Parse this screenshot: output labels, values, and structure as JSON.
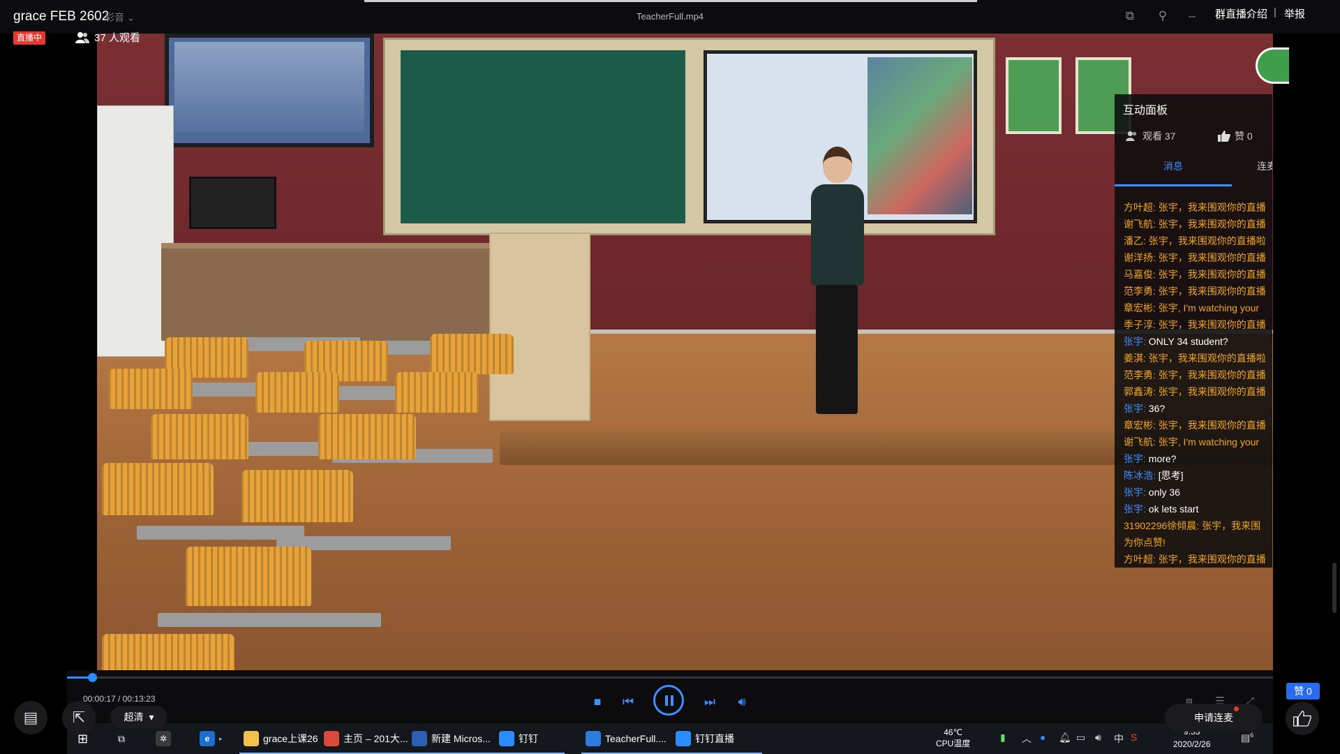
{
  "topbar": {
    "stream_title": "grace FEB 2602",
    "mute_label": "彩音",
    "live_badge": "直播中",
    "viewer_count": "37 人观看",
    "file_title": "TeacherFull.mp4",
    "intro_link": "群直播介绍",
    "separator": "|",
    "report_link": "举报"
  },
  "panel": {
    "title": "互动面板",
    "viewers": "观看 37",
    "likes": "赞 0",
    "tab_messages": "消息",
    "tab_mic": "连麦",
    "messages": [
      {
        "who": "方叶超:",
        "text": "张宇，我来围观你的直播",
        "blue": false
      },
      {
        "who": "谢飞航:",
        "text": "张宇，我来围观你的直播",
        "blue": false
      },
      {
        "who": "潘乙:",
        "text": "张宇，我来围观你的直播啦",
        "blue": false
      },
      {
        "who": "谢洋扬:",
        "text": "张宇，我来围观你的直播",
        "blue": false
      },
      {
        "who": "马嘉俊:",
        "text": "张宇，我来围观你的直播",
        "blue": false
      },
      {
        "who": "范李勇:",
        "text": "张宇，我来围观你的直播",
        "blue": false
      },
      {
        "who": "章宏彬:",
        "text": "张宇, I'm watching your",
        "blue": false
      },
      {
        "who": "季子淳:",
        "text": "张宇，我来围观你的直播",
        "blue": false
      },
      {
        "who": "张宇:",
        "text": "ONLY 34 student?",
        "blue": true
      },
      {
        "who": "姜淇:",
        "text": "张宇，我来围观你的直播啦",
        "blue": false
      },
      {
        "who": "范李勇:",
        "text": "张宇，我来围观你的直播",
        "blue": false
      },
      {
        "who": "郭鑫涛:",
        "text": "张宇，我来围观你的直播",
        "blue": false
      },
      {
        "who": "张宇:",
        "text": "36?",
        "blue": true
      },
      {
        "who": "章宏彬:",
        "text": "张宇，我来围观你的直播",
        "blue": false
      },
      {
        "who": "谢飞航:",
        "text": "张宇, I'm watching your",
        "blue": false
      },
      {
        "who": "张宇:",
        "text": "more?",
        "blue": true
      },
      {
        "who": "陈冰浩:",
        "text": "[思考]",
        "blue": true
      },
      {
        "who": "张宇:",
        "text": "only 36",
        "blue": true
      },
      {
        "who": "张宇:",
        "text": "ok  lets start",
        "blue": true
      },
      {
        "who": "31902296徐倾晨:",
        "text": "张宇，我来围",
        "blue": false
      },
      {
        "who": "",
        "text": "为你点赞!",
        "blue": false
      },
      {
        "who": "方叶超:",
        "text": "张宇，我来围观你的直播",
        "blue": false
      }
    ]
  },
  "player": {
    "time": "00:00:17 / 00:13:23",
    "progress_fraction": 0.021,
    "quality": "超清",
    "mic_request": "申请连麦",
    "like_badge": "赞 0"
  },
  "taskbar": {
    "apps": [
      {
        "label": "grace上课26",
        "icon": "folder-icon",
        "color": "#f2c04b"
      },
      {
        "label": "主页 – 201大...",
        "icon": "chrome-icon",
        "color": "#d94a3b"
      },
      {
        "label": "新建 Micros...",
        "icon": "word-icon",
        "color": "#2b5fb4"
      },
      {
        "label": "钉钉",
        "icon": "dingtalk-icon",
        "color": "#2b8cff"
      },
      {
        "label": "TeacherFull....",
        "icon": "player-icon",
        "color": "#2f7cdf"
      },
      {
        "label": "钉钉直播",
        "icon": "dingtalk-live-icon",
        "color": "#2b8cff"
      }
    ],
    "cpu_temp": "46℃",
    "cpu_label": "CPU温度",
    "ime": "中",
    "clock_time": "9:53",
    "clock_date": "2020/2/26",
    "notification_count": "6"
  },
  "colors": {
    "accent_blue": "#3f8fff",
    "live_red": "#e8372f",
    "message_orange": "#f2a623"
  }
}
